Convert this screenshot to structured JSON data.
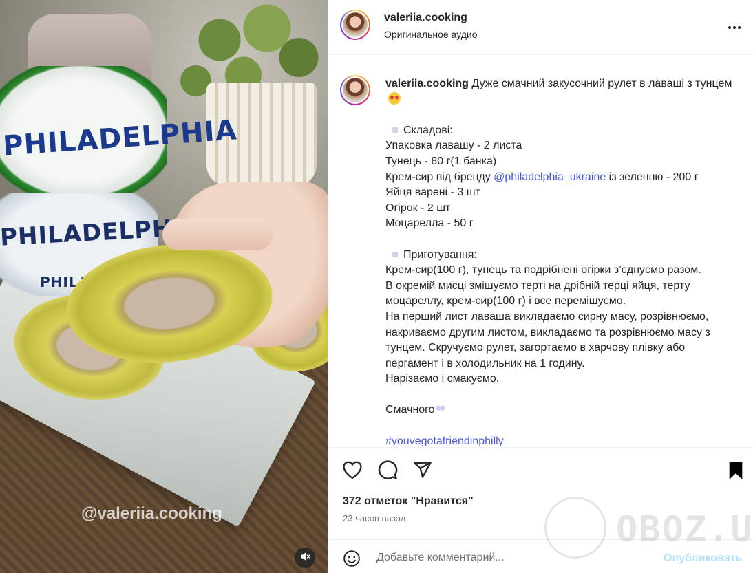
{
  "media": {
    "watermark_handle": "@valeriia.cooking",
    "brand_texts": [
      "PHILADELPHIA",
      "PHILADELPHIA",
      "PHILA"
    ],
    "mute_icon": "muted-speaker-icon"
  },
  "header": {
    "username": "valeriia.cooking",
    "audio": "Оригинальное аудио",
    "more_icon": "more-horizontal-icon"
  },
  "caption": {
    "username": "valeriia.cooking",
    "title": "Дуже смачний закусочний рулет в лаваші з тунцем",
    "ingredients_heading": "Складові:",
    "ingredients": [
      "Упаковка лавашу - 2 листа",
      "Тунець - 80 г(1 банка)",
      "Крем-сир від бренду",
      "Яйця варені - 3 шт",
      "Огірок - 2 шт",
      "Моцарелла - 50 г"
    ],
    "cream_mention": "@philadelphia_ukraine",
    "cream_suffix": " із зеленню - 200 г",
    "steps_heading": "Приготування:",
    "steps": [
      "Крем-сир(100 г), тунець та подрібнені огірки з’єднуємо разом.",
      "В окремій мисці змішуємо терті на дрібній терці яйця, терту моцареллу, крем-сир(100 г) і все перемішуємо.",
      "На перший лист лаваша викладаємо сирну масу, розрівнюємо, накриваємо другим листом, викладаємо та розрівнюємо масу з тунцем. Скручуємо рулет, загортаємо в харчову плівку або пергамент і в холодильник на 1 годину.",
      "Нарізаємо і смакуємо."
    ],
    "closing": "Смачного",
    "hashtag": "#youvegotafriendinphilly"
  },
  "actions": {
    "like_icon": "heart-outline-icon",
    "comment_icon": "comment-bubble-icon",
    "share_icon": "paper-plane-icon",
    "save_icon": "bookmark-filled-icon"
  },
  "likes": "372 отметок \"Нравится\"",
  "time": "23 часов назад",
  "comment": {
    "placeholder": "Добавьте комментарий...",
    "post_label": "Опубликовать",
    "emoji_icon": "smiley-icon"
  },
  "watermark": {
    "site": "OBOZ.UA"
  },
  "colors": {
    "link": "#4a58d6",
    "post_disabled": "#b2dffc",
    "secondary_text": "#737373",
    "border": "#efefef"
  }
}
